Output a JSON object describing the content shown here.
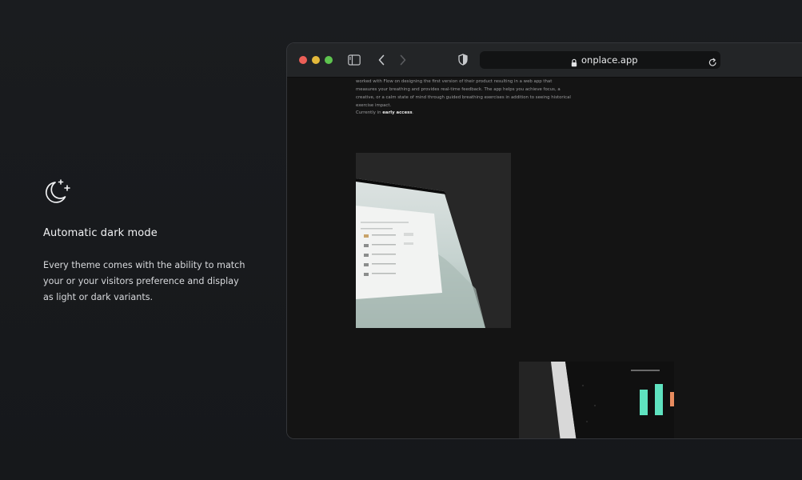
{
  "feature": {
    "icon": "moon-stars-icon",
    "title": "Automatic dark mode",
    "description": "Every theme comes with the ability to match your or your visitors preference and display as light or dark variants."
  },
  "browser": {
    "url": "onplace.app",
    "icons": [
      "sidebar-icon",
      "chevron-left-icon",
      "chevron-right-icon",
      "shield-icon",
      "lock-icon",
      "reload-icon"
    ]
  },
  "content": {
    "body_text": "worked with Flow on designing the first version of their product resulting in a web app that measures your breathing and provides real-time feedback. The app helps you achieve focus, a creative, or a calm state of mind through guided breathing exercises in addition to seeing historical exercise impact.",
    "access_prefix": "Currently in ",
    "access_highlight": "early access",
    "access_suffix": "."
  },
  "colors": {
    "page_bg": "#17191c",
    "traffic_red": "#ec5f57",
    "traffic_yellow": "#e4b93b",
    "traffic_green": "#5ec44f",
    "chart_teal": "#5fe3c0",
    "chart_orange": "#e88c5f"
  }
}
